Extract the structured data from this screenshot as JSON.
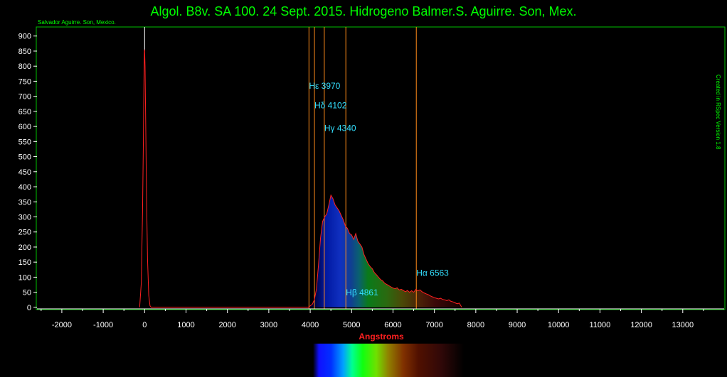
{
  "title": "Algol. B8v. SA 100. 24 Sept. 2015. Hidrogeno Balmer.S. Aguirre. Son, Mex.",
  "author_label": "Salvador Aguirre. Son, Mexico.",
  "software_label": "Created in RSpec Version 1.8",
  "colors": {
    "background": "#000000",
    "title": "#00ff00",
    "plot_frame": "#00c000",
    "curve": "#ff2020",
    "balmer_lines": "#ff8c1a",
    "line_labels": "#33e0ff",
    "axis_label": "#ff2020",
    "zero_marker": "#ffffff"
  },
  "chart_data": {
    "type": "line",
    "title": "Algol. B8v. SA 100. 24 Sept. 2015. Hidrogeno Balmer.S. Aguirre. Son, Mex.",
    "xlabel": "Angstroms",
    "ylabel": "",
    "xlim": [
      -2600,
      14000
    ],
    "ylim": [
      -5,
      930
    ],
    "grid": false,
    "x_ticks": [
      -2000,
      -1000,
      0,
      1000,
      2000,
      3000,
      4000,
      5000,
      6000,
      7000,
      8000,
      9000,
      10000,
      11000,
      12000,
      13000
    ],
    "y_ticks": [
      0,
      50,
      100,
      150,
      200,
      250,
      300,
      350,
      400,
      450,
      500,
      550,
      600,
      650,
      700,
      750,
      800,
      850,
      900
    ],
    "zero_order_marker_x": 0,
    "series": [
      {
        "points": [
          [
            -120,
            0
          ],
          [
            -80,
            80
          ],
          [
            -50,
            320
          ],
          [
            -30,
            560
          ],
          [
            -15,
            760
          ],
          [
            -5,
            850
          ],
          [
            0,
            855
          ],
          [
            10,
            800
          ],
          [
            25,
            620
          ],
          [
            45,
            380
          ],
          [
            70,
            160
          ],
          [
            100,
            40
          ],
          [
            130,
            5
          ],
          [
            160,
            0
          ],
          [
            3950,
            0
          ],
          [
            4050,
            10
          ],
          [
            4100,
            25
          ],
          [
            4150,
            60
          ],
          [
            4200,
            140
          ],
          [
            4250,
            230
          ],
          [
            4300,
            285
          ],
          [
            4350,
            300
          ],
          [
            4400,
            310
          ],
          [
            4450,
            340
          ],
          [
            4500,
            372
          ],
          [
            4550,
            360
          ],
          [
            4600,
            340
          ],
          [
            4650,
            330
          ],
          [
            4700,
            320
          ],
          [
            4750,
            305
          ],
          [
            4800,
            290
          ],
          [
            4850,
            270
          ],
          [
            4900,
            262
          ],
          [
            4950,
            245
          ],
          [
            5000,
            240
          ],
          [
            5050,
            225
          ],
          [
            5100,
            245
          ],
          [
            5150,
            220
          ],
          [
            5200,
            210
          ],
          [
            5250,
            200
          ],
          [
            5300,
            175
          ],
          [
            5350,
            160
          ],
          [
            5400,
            145
          ],
          [
            5450,
            135
          ],
          [
            5500,
            128
          ],
          [
            5550,
            115
          ],
          [
            5600,
            108
          ],
          [
            5650,
            100
          ],
          [
            5700,
            92
          ],
          [
            5750,
            88
          ],
          [
            5800,
            80
          ],
          [
            5850,
            76
          ],
          [
            5900,
            72
          ],
          [
            5950,
            68
          ],
          [
            6000,
            64
          ],
          [
            6050,
            62
          ],
          [
            6100,
            65
          ],
          [
            6150,
            58
          ],
          [
            6200,
            60
          ],
          [
            6250,
            56
          ],
          [
            6300,
            52
          ],
          [
            6350,
            56
          ],
          [
            6400,
            50
          ],
          [
            6450,
            55
          ],
          [
            6500,
            50
          ],
          [
            6550,
            60
          ],
          [
            6600,
            55
          ],
          [
            6650,
            58
          ],
          [
            6700,
            52
          ],
          [
            6750,
            48
          ],
          [
            6800,
            45
          ],
          [
            6850,
            42
          ],
          [
            6900,
            38
          ],
          [
            6950,
            35
          ],
          [
            7000,
            32
          ],
          [
            7050,
            30
          ],
          [
            7100,
            28
          ],
          [
            7150,
            30
          ],
          [
            7200,
            26
          ],
          [
            7250,
            25
          ],
          [
            7300,
            22
          ],
          [
            7350,
            25
          ],
          [
            7400,
            20
          ],
          [
            7450,
            18
          ],
          [
            7500,
            15
          ],
          [
            7550,
            12
          ],
          [
            7600,
            14
          ],
          [
            7640,
            5
          ],
          [
            7660,
            0
          ]
        ]
      }
    ],
    "annotations": [
      {
        "wavelength": 3970,
        "text": "Hε 3970",
        "y": 725
      },
      {
        "wavelength": 4102,
        "text": "Hδ 4102",
        "y": 660
      },
      {
        "wavelength": 4340,
        "text": "Hγ 4340",
        "y": 585
      },
      {
        "wavelength": 4861,
        "text": "Hβ 4861",
        "y": 40
      },
      {
        "wavelength": 6563,
        "text": "Hα 6563",
        "y": 105
      }
    ]
  }
}
